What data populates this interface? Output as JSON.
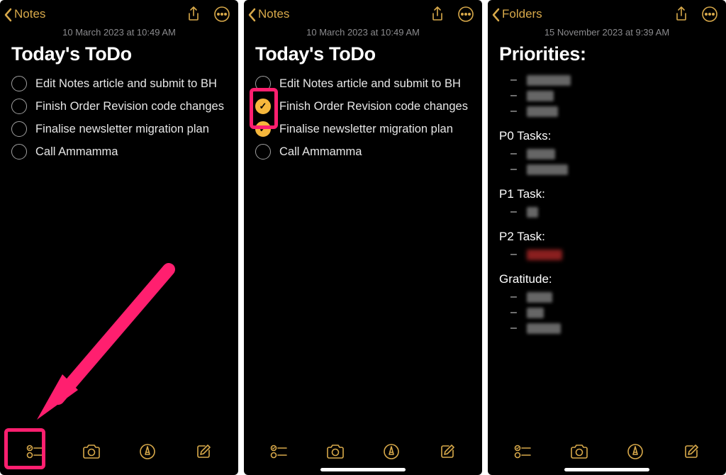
{
  "accent": "#d8a94a",
  "highlight": "#ff1f6f",
  "screen1": {
    "back_label": "Notes",
    "timestamp": "10 March 2023 at 10:49 AM",
    "title": "Today's ToDo",
    "items": [
      {
        "label": "Edit Notes article and submit to BH",
        "checked": false
      },
      {
        "label": "Finish Order Revision code changes",
        "checked": false
      },
      {
        "label": "Finalise newsletter migration plan",
        "checked": false
      },
      {
        "label": "Call Ammamma",
        "checked": false
      }
    ]
  },
  "screen2": {
    "back_label": "Notes",
    "timestamp": "10 March 2023 at 10:49 AM",
    "title": "Today's ToDo",
    "items": [
      {
        "label": "Edit Notes article and submit to BH",
        "checked": false
      },
      {
        "label": "Finish Order Revision code changes",
        "checked": true
      },
      {
        "label": "Finalise newsletter migration plan",
        "checked": true
      },
      {
        "label": "Call Ammamma",
        "checked": false
      }
    ]
  },
  "screen3": {
    "back_label": "Folders",
    "timestamp": "15 November 2023 at 9:39 AM",
    "title": "Priorities:",
    "sections": [
      {
        "heading": "",
        "redactions": [
          62,
          38,
          44
        ]
      },
      {
        "heading": "P0 Tasks:",
        "redactions": [
          40,
          58
        ]
      },
      {
        "heading": "P1 Task:",
        "redactions": [
          16
        ]
      },
      {
        "heading": "P2 Task:",
        "redactions": [
          50
        ],
        "red": true
      },
      {
        "heading": "Gratitude:",
        "redactions": [
          36,
          24,
          48
        ]
      }
    ]
  },
  "toolbar_icons": [
    "checklist-icon",
    "camera-icon",
    "markup-icon",
    "compose-icon"
  ]
}
